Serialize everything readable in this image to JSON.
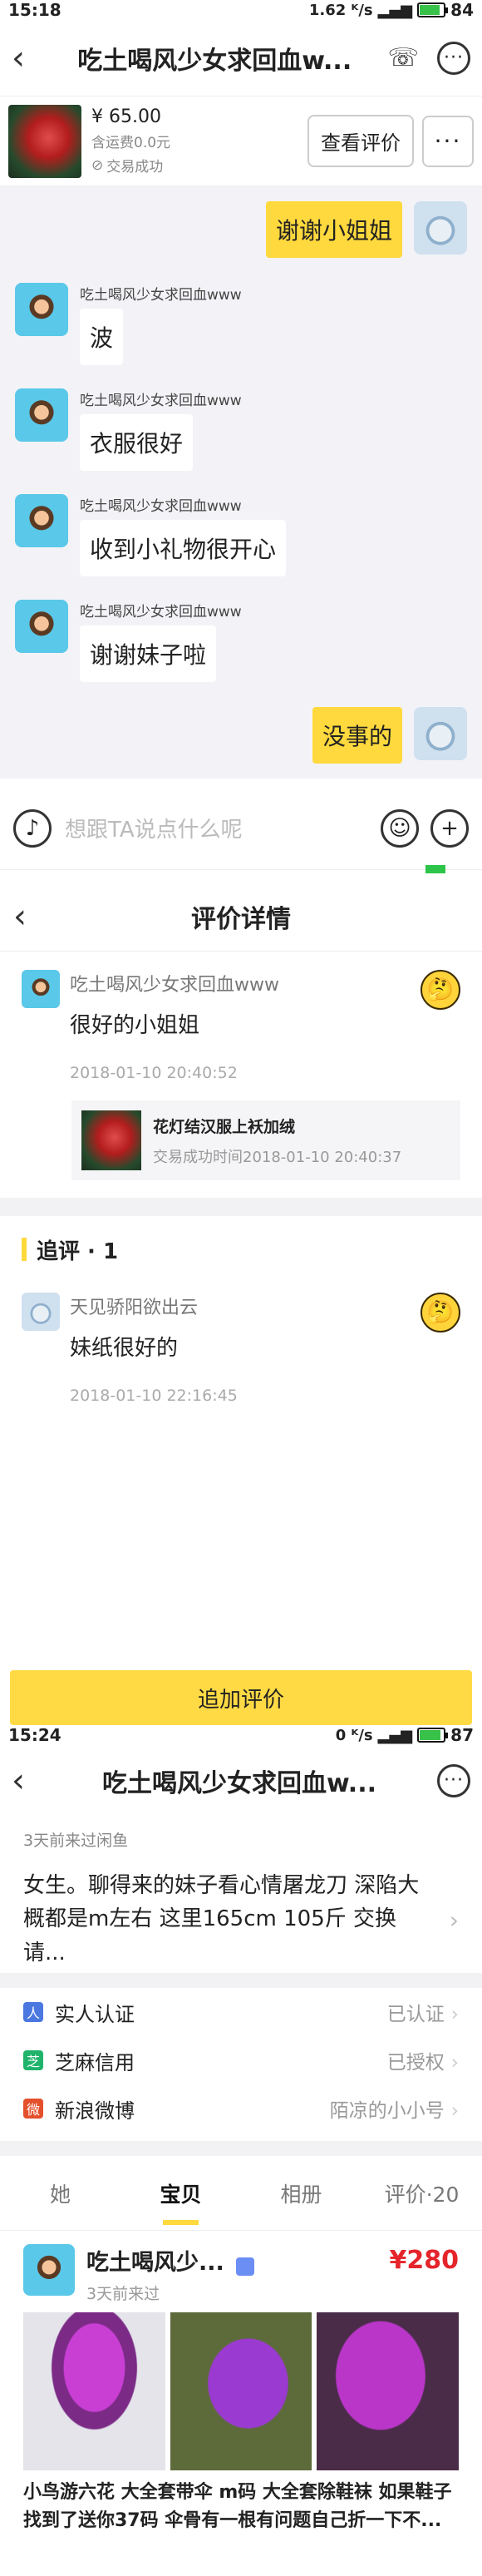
{
  "status1": {
    "time": "15:18",
    "net": "1.62 ᴷ/s",
    "battery": "84"
  },
  "chat": {
    "title": "吃土喝风少女求回血w...",
    "product": {
      "price": "¥ 65.00",
      "shipping": "含运费0.0元",
      "deal": "交易成功"
    },
    "view_review_label": "查看评价",
    "messages": [
      {
        "side": "right",
        "text": "谢谢小姐姐"
      },
      {
        "side": "left",
        "sender": "吃土喝风少女求回血www",
        "text": "波"
      },
      {
        "side": "left",
        "sender": "吃土喝风少女求回血www",
        "text": "衣服很好"
      },
      {
        "side": "left",
        "sender": "吃土喝风少女求回血www",
        "text": "收到小礼物很开心"
      },
      {
        "side": "left",
        "sender": "吃土喝风少女求回血www",
        "text": "谢谢妹子啦"
      },
      {
        "side": "right",
        "text": "没事的"
      }
    ],
    "input_placeholder": "想跟TA说点什么呢"
  },
  "review": {
    "title": "评价详情",
    "main": {
      "user": "吃土喝风少女求回血www",
      "text": "很好的小姐姐",
      "time": "2018-01-10 20:40:52"
    },
    "goods": {
      "title": "花灯结汉服上袄加绒",
      "sub": "交易成功时间2018-01-10 20:40:37"
    },
    "followup_label": "追评 · 1",
    "followup": {
      "user": "天见骄阳欲出云",
      "text": "妹纸很好的",
      "time": "2018-01-10 22:16:45"
    },
    "add_button": "追加评价"
  },
  "status2": {
    "time": "15:24",
    "net": "0 ᴷ/s",
    "battery": "87"
  },
  "profile": {
    "title": "吃土喝风少女求回血w...",
    "last_seen": "3天前来过闲鱼",
    "bio": "女生。聊得来的妹子看心情屠龙刀 深陷大概都是m左右 这里165cm 105斤 交换请...",
    "auth": [
      {
        "label": "实人认证",
        "value": "已认证",
        "color": "#4a78e0",
        "icon": "person-icon"
      },
      {
        "label": "芝麻信用",
        "value": "已授权",
        "color": "#1fb36b",
        "icon": "sesame-icon"
      },
      {
        "label": "新浪微博",
        "value": "陌凉的小小号",
        "color": "#e4502c",
        "icon": "weibo-icon"
      }
    ],
    "tabs": [
      "她",
      "宝贝",
      "相册",
      "评价·20"
    ],
    "listing": {
      "seller": "吃土喝风少...",
      "time": "3天前来过",
      "price": "¥280",
      "description": "小鸟游六花 大全套带伞 m码 大全套除鞋袜 如果鞋子找到了送你37码 伞骨有一根有问题自己折一下不..."
    }
  }
}
